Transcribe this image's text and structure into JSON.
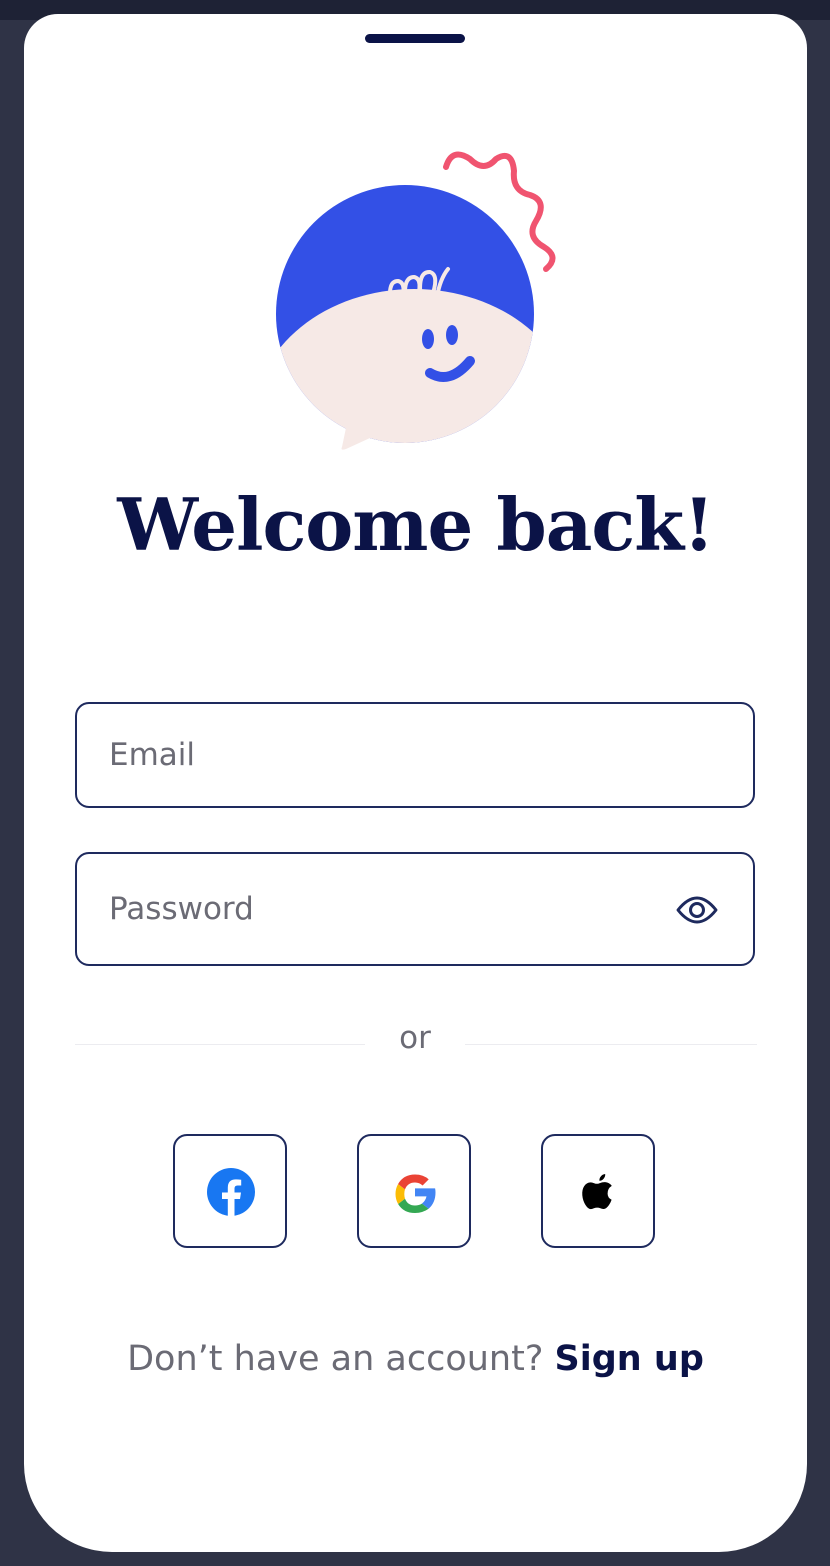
{
  "title": "Welcome back!",
  "email": {
    "placeholder": "Email",
    "value": ""
  },
  "password": {
    "placeholder": "Password",
    "value": ""
  },
  "divider": {
    "label": "or"
  },
  "social": [
    {
      "name": "facebook",
      "icon": "facebook-icon",
      "color": "#1877F2"
    },
    {
      "name": "google",
      "icon": "google-icon"
    },
    {
      "name": "apple",
      "icon": "apple-icon",
      "color": "#000000"
    }
  ],
  "signup": {
    "prompt": "Don’t have an account?",
    "link": "Sign up"
  },
  "colors": {
    "navy": "#0b1347",
    "mascot_blue": "#3350e6",
    "mascot_cream": "#f6e9e6",
    "accent_pink": "#f05470",
    "muted_text": "#6b6b75"
  }
}
